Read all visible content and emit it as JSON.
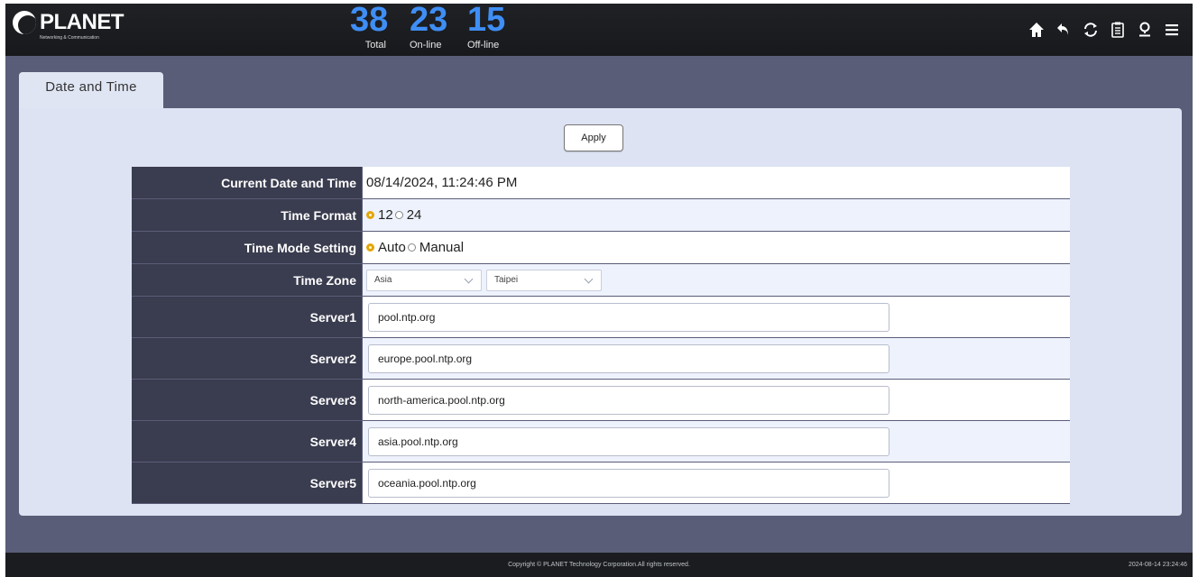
{
  "header": {
    "logo_text": "PLANET",
    "logo_sub": "Networking & Communication",
    "stats": {
      "total": {
        "value": "38",
        "label": "Total"
      },
      "online": {
        "value": "23",
        "label": "On-line"
      },
      "offline": {
        "value": "15",
        "label": "Off-line"
      }
    },
    "icons": [
      "home-icon",
      "back-icon",
      "refresh-icon",
      "clipboard-icon",
      "location-pin-icon",
      "menu-icon"
    ]
  },
  "tab": {
    "label": "Date and Time"
  },
  "apply_label": "Apply",
  "form": {
    "current": {
      "label": "Current Date and Time",
      "value": "08/14/2024, 11:24:46 PM"
    },
    "time_format": {
      "label": "Time Format",
      "options": [
        "12",
        "24"
      ],
      "selected": "12"
    },
    "time_mode": {
      "label": "Time Mode Setting",
      "options": [
        "Auto",
        "Manual"
      ],
      "selected": "Auto"
    },
    "time_zone": {
      "label": "Time Zone",
      "region": "Asia",
      "city": "Taipei"
    },
    "servers": [
      {
        "label": "Server1",
        "value": "pool.ntp.org"
      },
      {
        "label": "Server2",
        "value": "europe.pool.ntp.org"
      },
      {
        "label": "Server3",
        "value": "north-america.pool.ntp.org"
      },
      {
        "label": "Server4",
        "value": "asia.pool.ntp.org"
      },
      {
        "label": "Server5",
        "value": "oceania.pool.ntp.org"
      }
    ]
  },
  "footer": {
    "copyright": "Copyright © PLANET Technology Corporation.All rights reserved.",
    "timestamp": "2024-08-14 23:24:46"
  },
  "colors": {
    "accent_blue": "#3f8ef5",
    "radio_selected": "#e2a60a",
    "header_bg": "#1f2125",
    "label_bg": "#3a3c4f"
  }
}
